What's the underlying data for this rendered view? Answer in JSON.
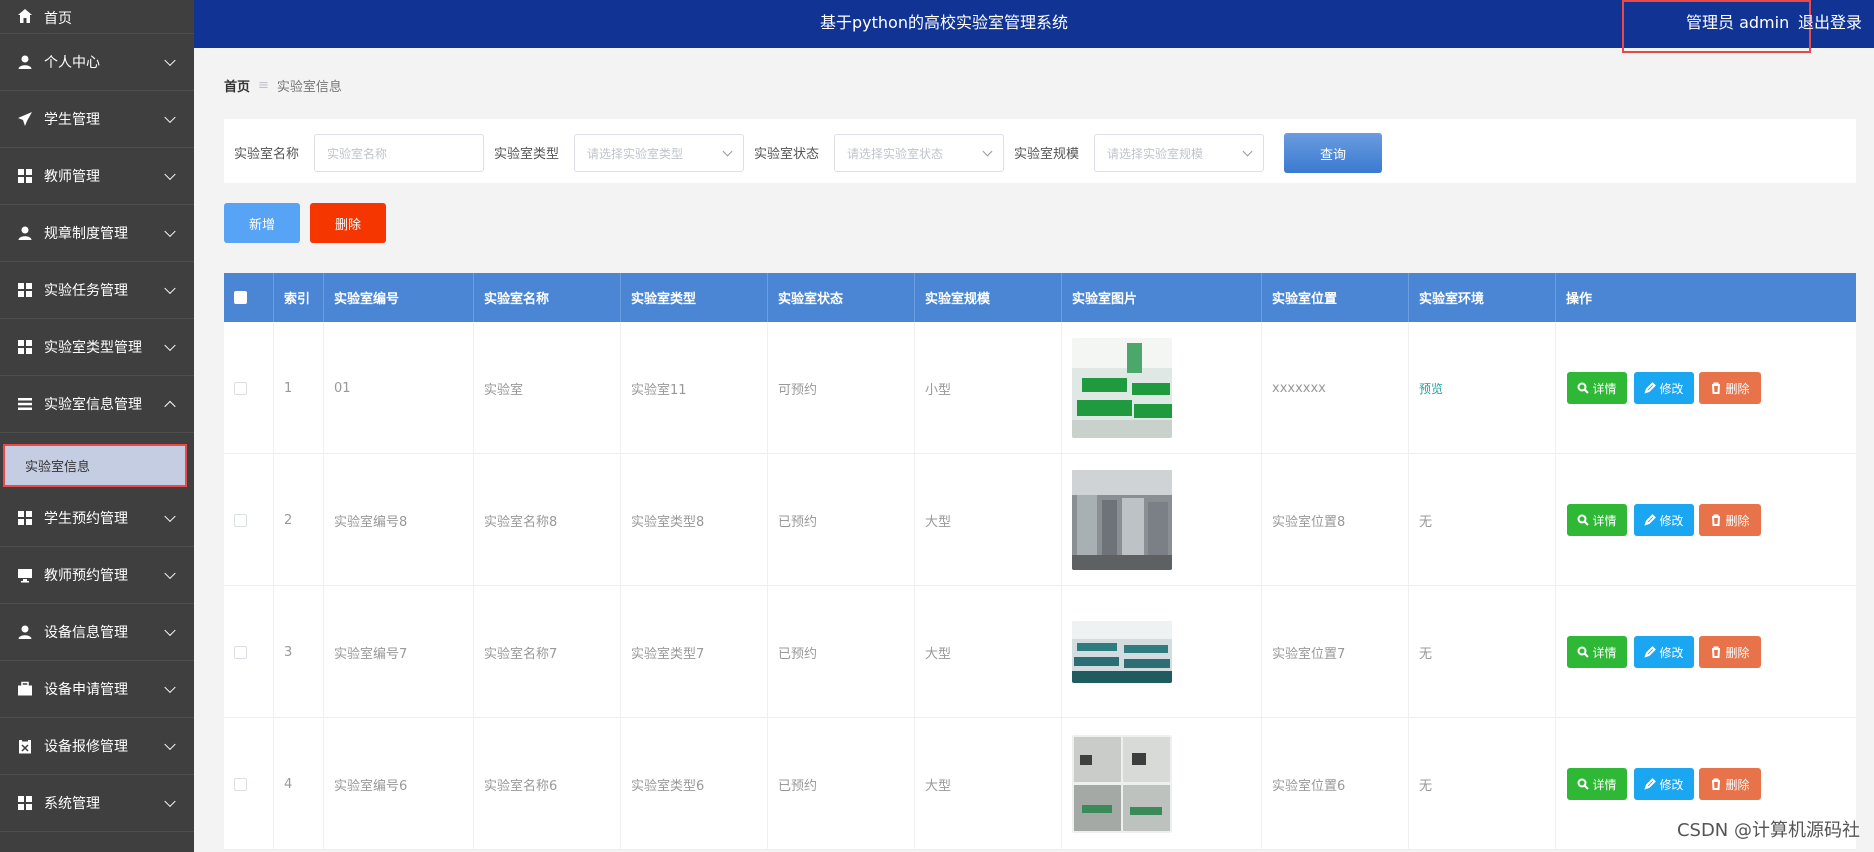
{
  "sidebar": {
    "items": [
      {
        "label": "首页",
        "icon": "home-icon"
      },
      {
        "label": "个人中心",
        "icon": "user-icon"
      },
      {
        "label": "学生管理",
        "icon": "send-icon"
      },
      {
        "label": "教师管理",
        "icon": "grid-icon"
      },
      {
        "label": "规章制度管理",
        "icon": "user-icon"
      },
      {
        "label": "实验任务管理",
        "icon": "grid-icon"
      },
      {
        "label": "实验室类型管理",
        "icon": "grid-icon"
      },
      {
        "label": "实验室信息管理",
        "icon": "list-icon"
      },
      {
        "label": "学生预约管理",
        "icon": "grid-icon"
      },
      {
        "label": "教师预约管理",
        "icon": "monitor-icon"
      },
      {
        "label": "设备信息管理",
        "icon": "user-icon"
      },
      {
        "label": "设备申请管理",
        "icon": "briefcase-icon"
      },
      {
        "label": "设备报修管理",
        "icon": "clipboard-icon"
      },
      {
        "label": "系统管理",
        "icon": "grid-icon"
      }
    ],
    "submenu_active": "实验室信息"
  },
  "header": {
    "title": "基于python的高校实验室管理系统",
    "user": "管理员 admin",
    "logout": "退出登录"
  },
  "breadcrumb": {
    "home": "首页",
    "separator": "≡",
    "current": "实验室信息"
  },
  "search": {
    "name_label": "实验室名称",
    "name_placeholder": "实验室名称",
    "type_label": "实验室类型",
    "type_placeholder": "请选择实验室类型",
    "status_label": "实验室状态",
    "status_placeholder": "请选择实验室状态",
    "scale_label": "实验室规模",
    "scale_placeholder": "请选择实验室规模",
    "query_button": "查询"
  },
  "actions": {
    "add": "新增",
    "delete": "删除"
  },
  "table": {
    "columns": [
      "索引",
      "实验室编号",
      "实验室名称",
      "实验室类型",
      "实验室状态",
      "实验室规模",
      "实验室图片",
      "实验室位置",
      "实验室环境",
      "操作"
    ],
    "rows": [
      {
        "index": "1",
        "code": "01",
        "name": "实验室",
        "type": "实验室11",
        "status": "可预约",
        "scale": "小型",
        "location": "xxxxxxx",
        "env": "预览"
      },
      {
        "index": "2",
        "code": "实验室编号8",
        "name": "实验室名称8",
        "type": "实验室类型8",
        "status": "已预约",
        "scale": "大型",
        "location": "实验室位置8",
        "env": "无"
      },
      {
        "index": "3",
        "code": "实验室编号7",
        "name": "实验室名称7",
        "type": "实验室类型7",
        "status": "已预约",
        "scale": "大型",
        "location": "实验室位置7",
        "env": "无"
      },
      {
        "index": "4",
        "code": "实验室编号6",
        "name": "实验室名称6",
        "type": "实验室类型6",
        "status": "已预约",
        "scale": "大型",
        "location": "实验室位置6",
        "env": "无"
      }
    ],
    "ops": {
      "detail": "详情",
      "edit": "修改",
      "delete": "删除"
    }
  },
  "watermark": "CSDN @计算机源码社",
  "colors": {
    "sidebar": "#3f3f3f",
    "header": "#113393",
    "table_header": "#4a86d3",
    "detail": "#2fb836",
    "edit": "#1aa6f0",
    "delete": "#e8734a",
    "danger": "#f53600",
    "primary": "#57a3f5"
  }
}
